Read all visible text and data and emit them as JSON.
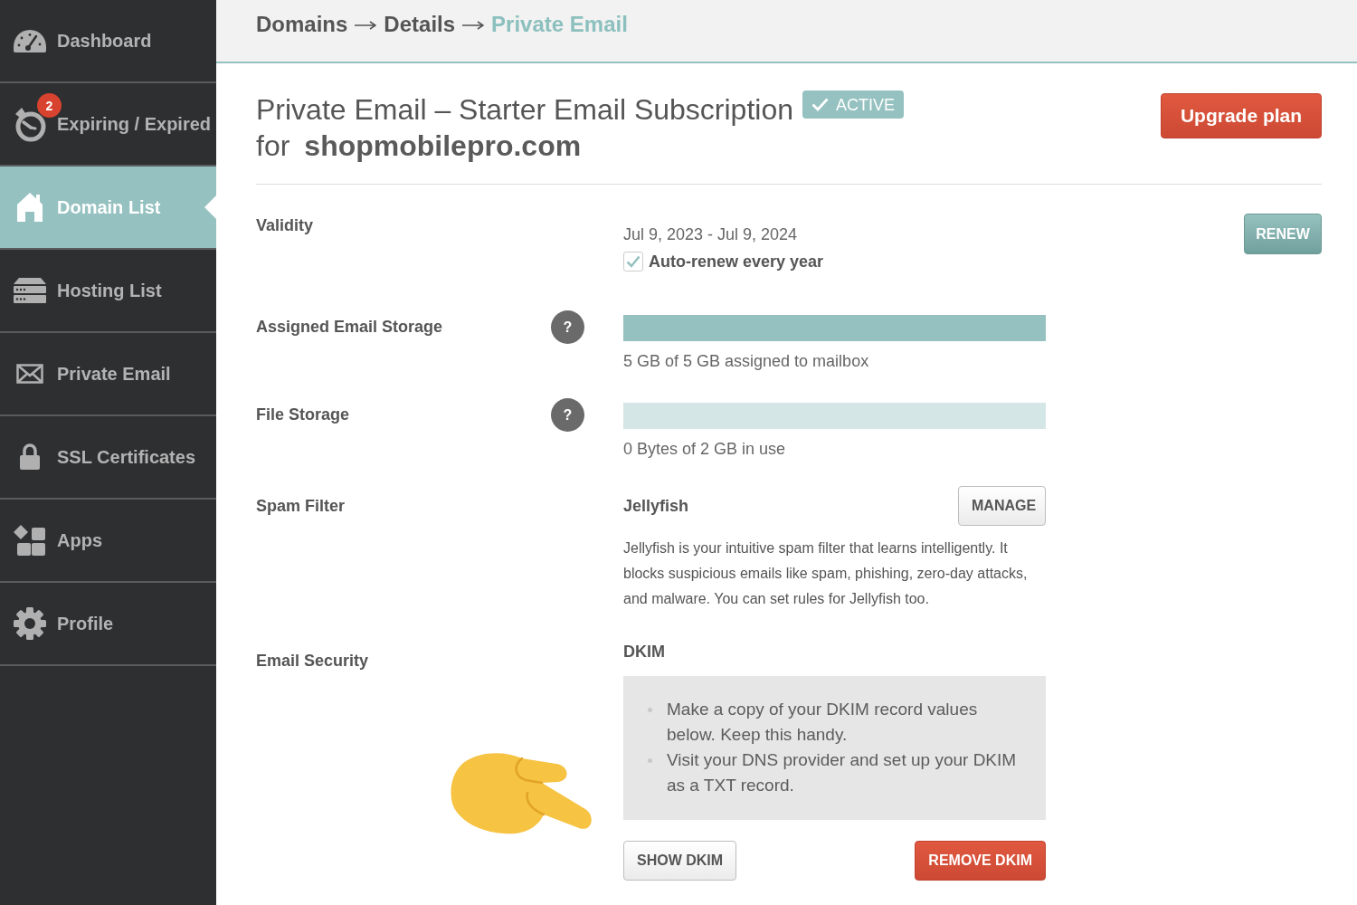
{
  "sidebar": {
    "items": [
      {
        "label": "Dashboard",
        "selected": false
      },
      {
        "label": "Expiring / Expired",
        "selected": false,
        "badge": "2"
      },
      {
        "label": "Domain List",
        "selected": true
      },
      {
        "label": "Hosting List",
        "selected": false
      },
      {
        "label": "Private Email",
        "selected": false
      },
      {
        "label": "SSL Certificates",
        "selected": false
      },
      {
        "label": "Apps",
        "selected": false
      },
      {
        "label": "Profile",
        "selected": false
      }
    ]
  },
  "breadcrumb": [
    {
      "label": "Domains",
      "selected": false
    },
    {
      "label": "Details",
      "selected": false
    },
    {
      "label": "Private Email",
      "selected": true
    }
  ],
  "header": {
    "title": "Private Email – Starter Email Subscription",
    "status": "ACTIVE",
    "for_label": "for",
    "domain": "shopmobilepro.com",
    "upgrade_button": "Upgrade plan"
  },
  "rows": [
    {
      "kind": "validity",
      "label": "Validity",
      "dates": "Jul 9, 2023 - Jul 9, 2024",
      "auto_renew": {
        "label": "Auto-renew every year",
        "checked": true
      },
      "button": "RENEW"
    },
    {
      "kind": "storage",
      "label": "Assigned Email Storage",
      "help": "?",
      "level": 1,
      "reading": "5 GB of 5 GB assigned to mailbox"
    },
    {
      "kind": "storage",
      "label": "File Storage",
      "help": "?",
      "level": 0,
      "reading": "0 Bytes of 2 GB in use"
    },
    {
      "kind": "spam",
      "label": "Spam Filter",
      "name": "Jellyfish",
      "button": "MANAGE",
      "description": "Jellyfish is your intuitive spam filter that learns intelligently. It blocks suspicious emails like spam, phishing, zero-day attacks, and malware. You can set rules for Jellyfish too."
    },
    {
      "kind": "dkim",
      "label": "Email Security",
      "heading": "DKIM",
      "steps": [
        "Make a copy of your DKIM record values below. Keep this handy.",
        "Visit your DNS provider and set up your DKIM as a TXT record."
      ],
      "buttons": [
        {
          "label": "SHOW DKIM",
          "kind": "secondary"
        },
        {
          "label": "REMOVE DKIM",
          "kind": "danger"
        }
      ]
    }
  ]
}
